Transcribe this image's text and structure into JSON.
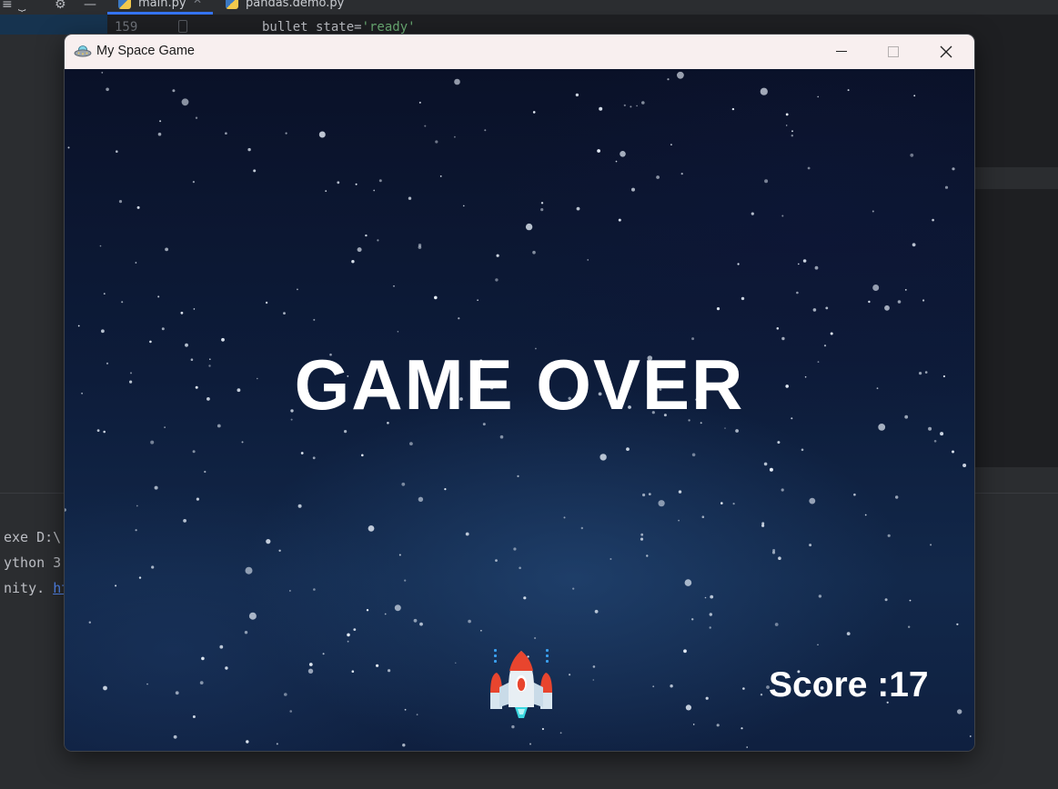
{
  "ide": {
    "tabs": [
      {
        "label": "main.py",
        "active": true
      },
      {
        "label": "pandas.demo.py",
        "active": false
      }
    ],
    "line_number": "159",
    "code_line": {
      "prefix": "bullet_state=",
      "string": "'ready'"
    },
    "console_lines": [
      {
        "text": "exe D:\\"
      },
      {
        "text": "ython 3."
      },
      {
        "text": "nity. ",
        "link": "ht"
      }
    ]
  },
  "window": {
    "title": "My Space Game",
    "icon": "ufo-icon",
    "controls": {
      "minimize": "minimize-icon",
      "maximize": "maximize-icon",
      "close": "close-icon"
    }
  },
  "game": {
    "game_over_text": "GAME OVER",
    "score_label": "Score :",
    "score_value": "17",
    "player_icon": "rocket-ship-icon"
  },
  "colors": {
    "accent_tab": "#3574f0",
    "string_green": "#6aab73",
    "link_blue": "#548af7",
    "titlebar_bg": "#f8efef",
    "space_bg": "#0d1c3a"
  }
}
